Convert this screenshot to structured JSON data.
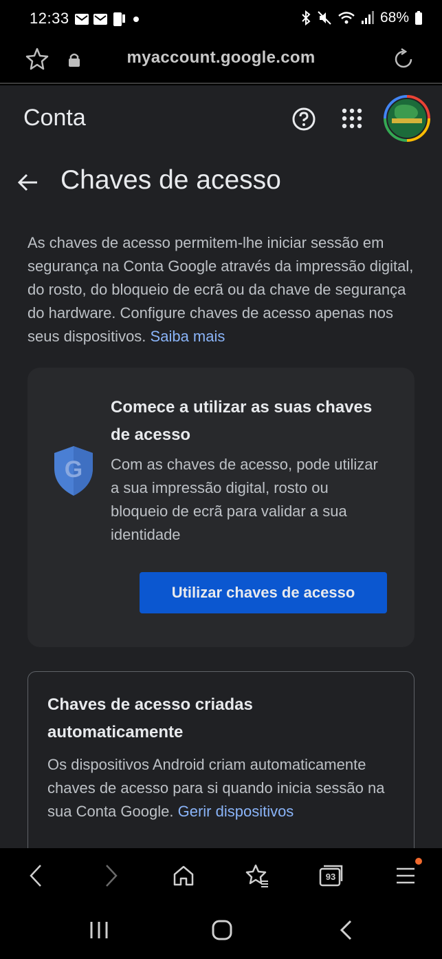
{
  "status_bar": {
    "time": "12:33",
    "battery": "68%",
    "icons": [
      "mail-icon",
      "mail-icon",
      "phone-notification-icon",
      "dot-icon",
      "bluetooth-icon",
      "mute-icon",
      "wifi-icon",
      "signal-icon",
      "battery-icon"
    ]
  },
  "browser": {
    "url": "myaccount.google.com",
    "tab_count": "93"
  },
  "app_header": {
    "title": "Conta"
  },
  "page_header": {
    "title": "Chaves de acesso"
  },
  "intro": {
    "text": "As chaves de acesso permitem-lhe iniciar sessão em segurança na Conta Google através da impressão digital, do rosto, do bloqueio de ecrã ou da chave de segurança do hardware. Configure chaves de acesso apenas nos seus dispositivos.",
    "link": "Saiba mais"
  },
  "start_card": {
    "title": "Comece a utilizar as suas chaves de acesso",
    "description": "Com as chaves de acesso, pode utilizar a sua impressão digital, rosto ou bloqueio de ecrã para validar a sua identidade",
    "button": "Utilizar chaves de acesso"
  },
  "auto_card": {
    "title": "Chaves de acesso criadas automaticamente",
    "description": "Os dispositivos Android criam automaticamente chaves de acesso para si quando inicia sessão na sua Conta Google.",
    "link": "Gerir dispositivos"
  },
  "colors": {
    "background": "#202124",
    "card": "#28292c",
    "accent_button": "#0b57d0",
    "link": "#8ab4f8",
    "notification_dot": "#f26a2e"
  }
}
